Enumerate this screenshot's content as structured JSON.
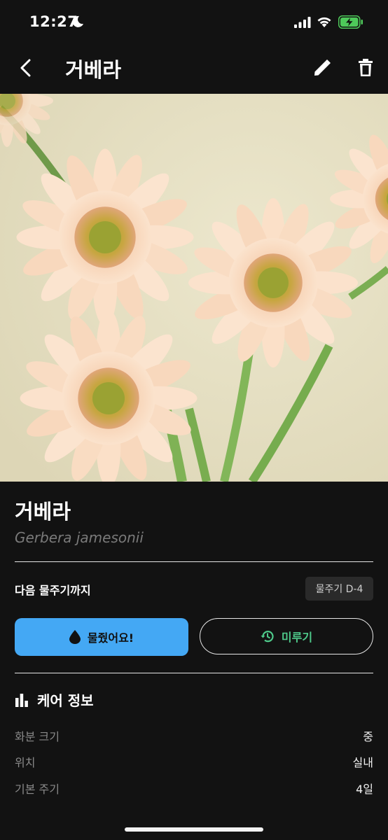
{
  "status_bar": {
    "time": "12:27"
  },
  "app_bar": {
    "title": "거베라"
  },
  "plant": {
    "name": "거베라",
    "scientific_name": "Gerbera jamesonii"
  },
  "watering": {
    "next_label": "다음 물주기까지",
    "dday_badge": "물주기 D-4",
    "water_button": "물줬어요!",
    "delay_button": "미루기"
  },
  "care": {
    "section_title": "케어 정보",
    "rows": [
      {
        "label": "화분 크기",
        "value": "중"
      },
      {
        "label": "위치",
        "value": "실내"
      },
      {
        "label": "기본 주기",
        "value": "4일"
      }
    ]
  },
  "colors": {
    "accent_blue": "#44a8f4",
    "accent_green": "#4ec98a",
    "background": "#121212"
  }
}
